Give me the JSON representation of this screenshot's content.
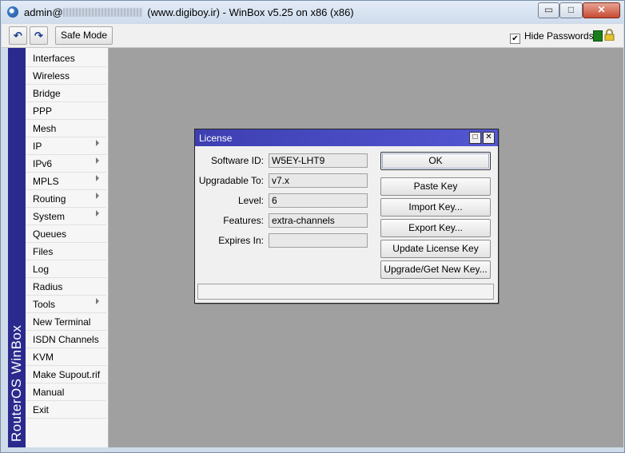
{
  "window": {
    "title_prefix": "admin@",
    "title_suffix": "(www.digiboy.ir) - WinBox v5.25 on x86 (x86)",
    "minimize_glyph": "▭",
    "maximize_glyph": "□",
    "close_glyph": "✕"
  },
  "toolbar": {
    "undo_glyph": "↶",
    "redo_glyph": "↷",
    "safe_mode_label": "Safe Mode",
    "hide_passwords_label": "Hide Passwords",
    "hide_passwords_checked": "✔",
    "status_color": "#1a7d1a"
  },
  "sidebar": {
    "brand": "RouterOS WinBox",
    "items": [
      {
        "label": "Interfaces",
        "submenu": false
      },
      {
        "label": "Wireless",
        "submenu": false
      },
      {
        "label": "Bridge",
        "submenu": false
      },
      {
        "label": "PPP",
        "submenu": false
      },
      {
        "label": "Mesh",
        "submenu": false
      },
      {
        "label": "IP",
        "submenu": true
      },
      {
        "label": "IPv6",
        "submenu": true
      },
      {
        "label": "MPLS",
        "submenu": true
      },
      {
        "label": "Routing",
        "submenu": true
      },
      {
        "label": "System",
        "submenu": true
      },
      {
        "label": "Queues",
        "submenu": false
      },
      {
        "label": "Files",
        "submenu": false
      },
      {
        "label": "Log",
        "submenu": false
      },
      {
        "label": "Radius",
        "submenu": false
      },
      {
        "label": "Tools",
        "submenu": true
      },
      {
        "label": "New Terminal",
        "submenu": false
      },
      {
        "label": "ISDN Channels",
        "submenu": false
      },
      {
        "label": "KVM",
        "submenu": false
      },
      {
        "label": "Make Supout.rif",
        "submenu": false
      },
      {
        "label": "Manual",
        "submenu": false
      },
      {
        "label": "Exit",
        "submenu": false
      }
    ]
  },
  "license_dialog": {
    "title": "License",
    "restore_glyph": "□",
    "close_glyph": "✕",
    "fields": [
      {
        "label": "Software ID:",
        "value": "W5EY-LHT9"
      },
      {
        "label": "Upgradable To:",
        "value": "v7.x"
      },
      {
        "label": "Level:",
        "value": "6"
      },
      {
        "label": "Features:",
        "value": "extra-channels"
      },
      {
        "label": "Expires In:",
        "value": ""
      }
    ],
    "buttons": {
      "ok": "OK",
      "paste_key": "Paste Key",
      "import_key": "Import Key...",
      "export_key": "Export Key...",
      "update_license_key": "Update License Key",
      "upgrade_get_new_key": "Upgrade/Get New Key..."
    }
  },
  "colors": {
    "sidebar_strip": "#2a2a8e",
    "dialog_title": "#3d3fb1",
    "workspace": "#a0a0a0"
  }
}
